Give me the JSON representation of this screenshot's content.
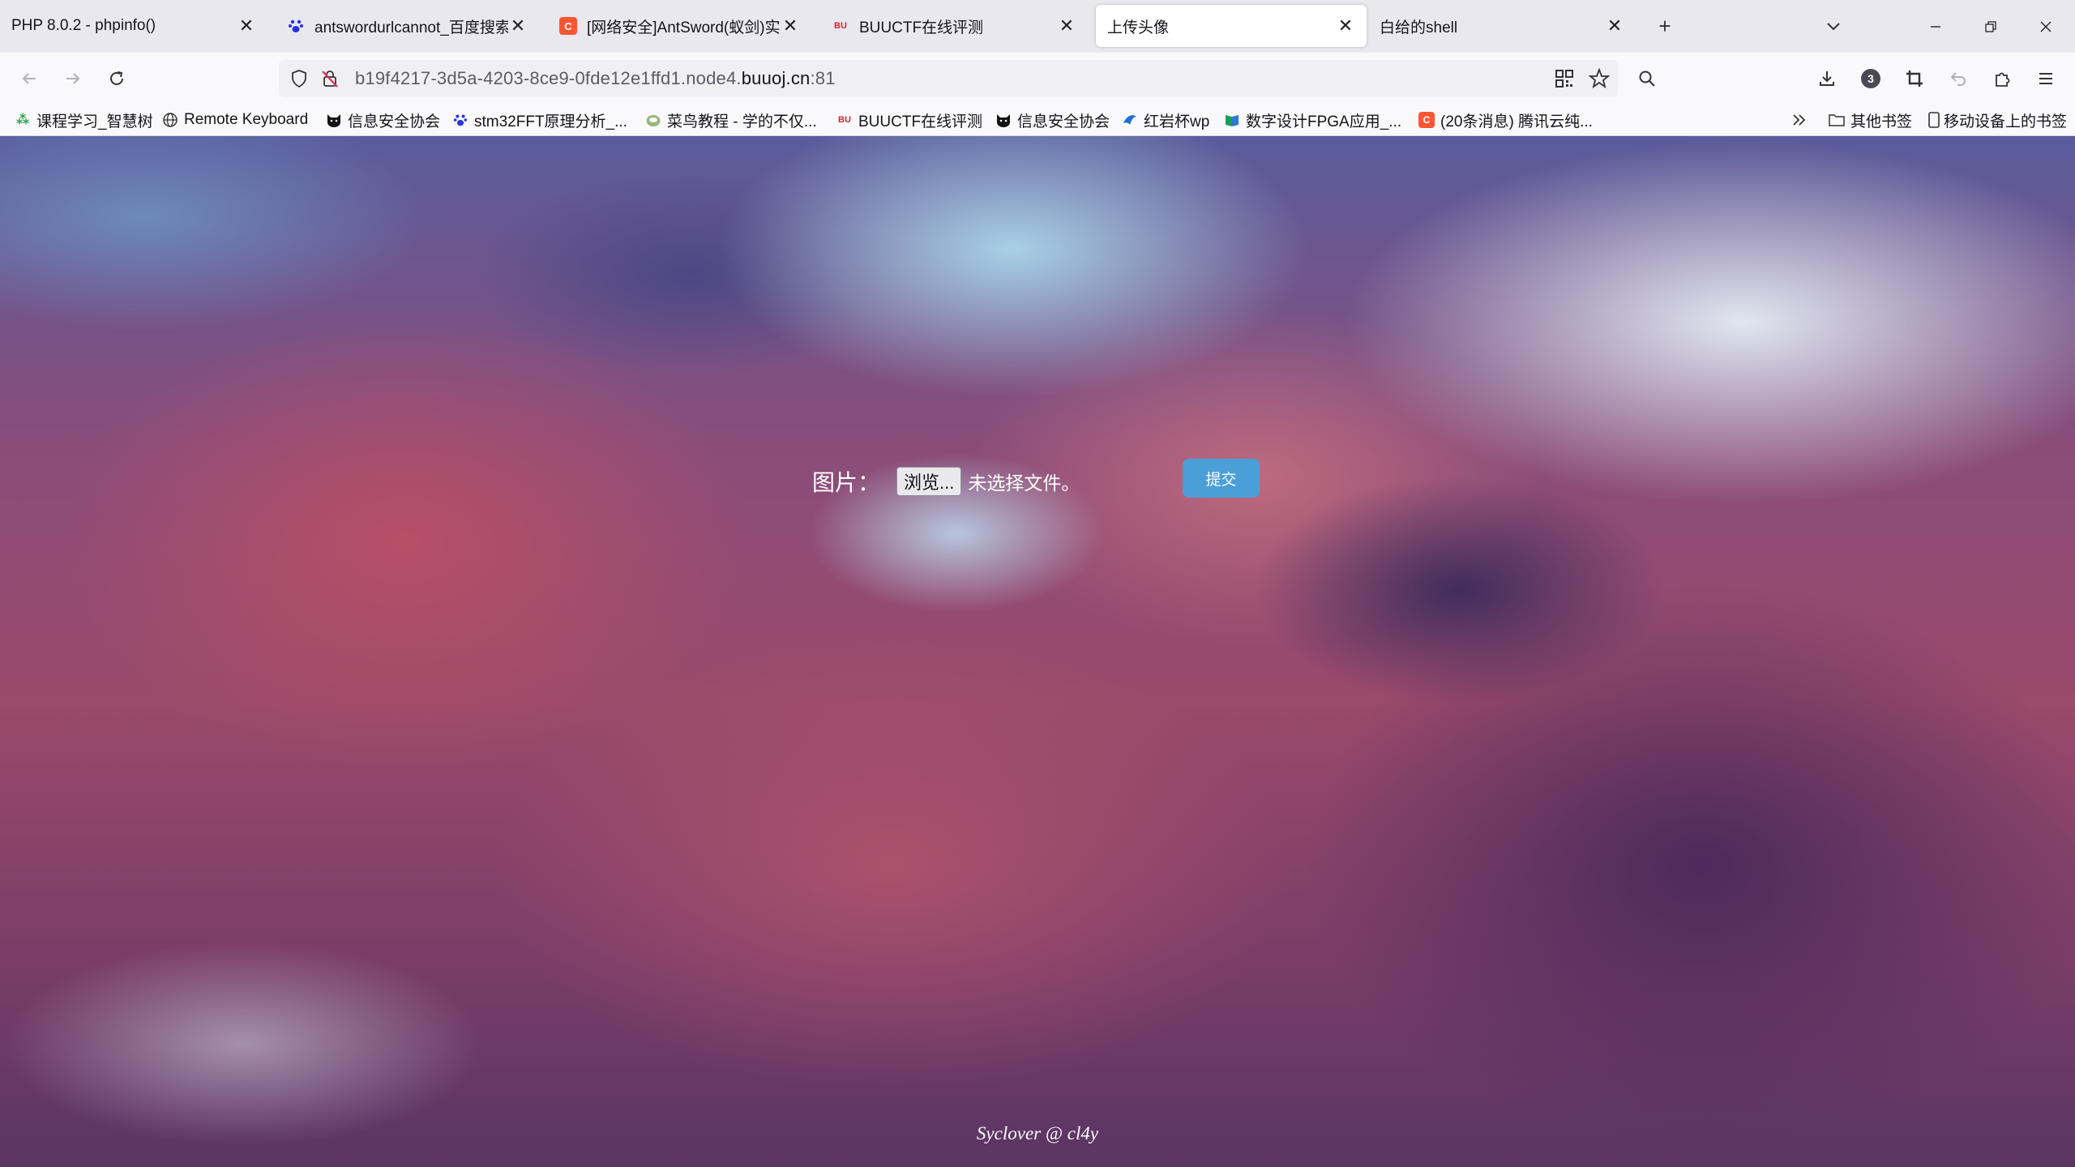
{
  "tabs": [
    {
      "title": "PHP 8.0.2 - phpinfo()",
      "active": false
    },
    {
      "title": "antswordurlcannot_百度搜索",
      "active": false
    },
    {
      "title": "[网络安全]AntSword(蚁剑)实战",
      "active": false
    },
    {
      "title": "BUUCTF在线评测",
      "active": false
    },
    {
      "title": "上传头像",
      "active": true
    },
    {
      "title": "白给的shell",
      "active": false
    }
  ],
  "nav": {
    "url_prefix": "b19f4217-3d5a-4203-8ce9-0fde12e1ffd1.node4.",
    "url_domain": "buuoj.cn",
    "url_suffix": ":81",
    "extensions_badge": "3"
  },
  "bookmarks": [
    {
      "label": "课程学习_智慧树",
      "icon": "zhihuishu-icon"
    },
    {
      "label": "Remote Keyboard",
      "icon": "globe-icon"
    },
    {
      "label": "信息安全协会",
      "icon": "cat-icon"
    },
    {
      "label": "stm32FFT原理分析_...",
      "icon": "baidu-paw-icon"
    },
    {
      "label": "菜鸟教程 - 学的不仅...",
      "icon": "runoob-icon"
    },
    {
      "label": "BUUCTF在线评测",
      "icon": "buuctf-icon"
    },
    {
      "label": "信息安全协会",
      "icon": "cat-icon"
    },
    {
      "label": "红岩杯wp",
      "icon": "bird-icon"
    },
    {
      "label": "数字设计FPGA应用_...",
      "icon": "book-icon"
    },
    {
      "label": "(20条消息) 腾讯云纯...",
      "icon": "csdn-icon"
    }
  ],
  "bookmarks_right": {
    "other": "其他书签",
    "mobile": "移动设备上的书签"
  },
  "page": {
    "field_label": "图片：",
    "browse_label": "浏览...",
    "no_file_text": "未选择文件。",
    "submit_label": "提交",
    "footer": "Syclover @ cl4y"
  },
  "colors": {
    "submit": "#4a9fd8",
    "tabbar": "#e8e8ee",
    "navbar": "#f9f9fb"
  }
}
